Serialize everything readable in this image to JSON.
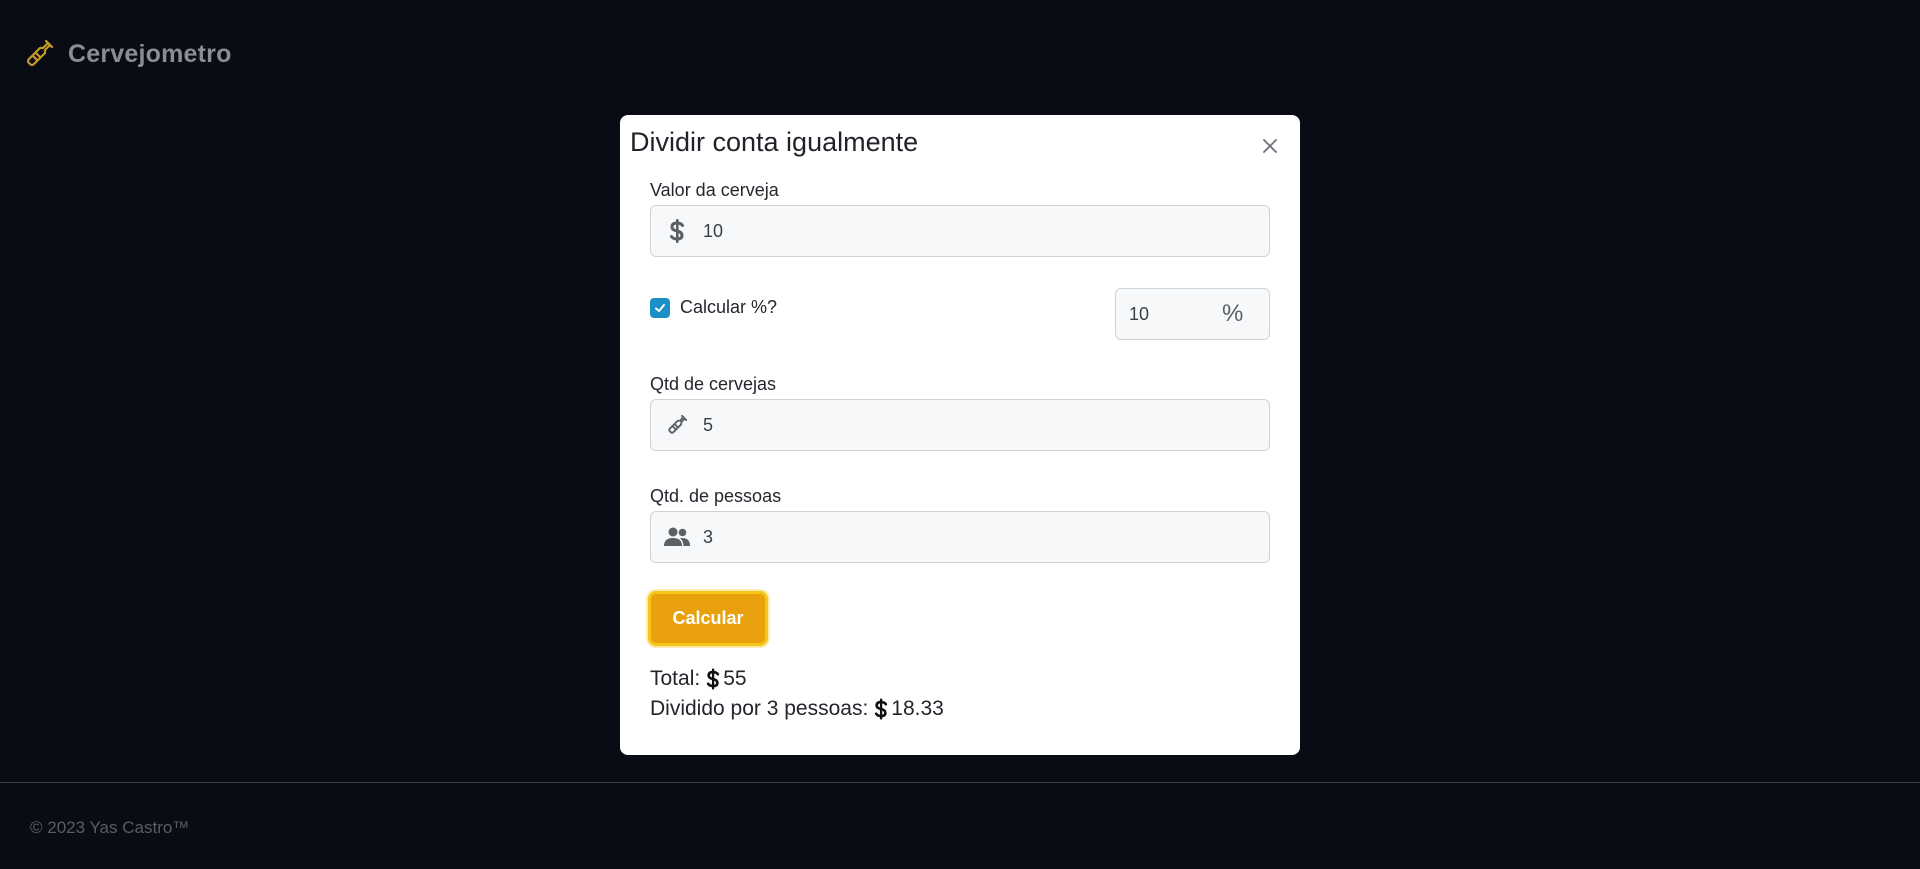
{
  "brand": {
    "name": "Cervejometro",
    "icon": "beer-bottle-icon"
  },
  "modal": {
    "title": "Dividir conta igualmente",
    "close_icon": "close-icon",
    "beer_price": {
      "label": "Valor da cerveja",
      "value": "10",
      "icon": "dollar-icon"
    },
    "percent": {
      "label": "Calcular %?",
      "checked": true,
      "value": "10",
      "suffix": "%"
    },
    "beer_qty": {
      "label": "Qtd de cervejas",
      "value": "5",
      "icon": "beer-bottle-icon"
    },
    "people_qty": {
      "label": "Qtd. de pessoas",
      "value": "3",
      "icon": "users-icon"
    },
    "calculate_label": "Calcular",
    "total_label": "Total:",
    "total_value": "55",
    "split_label": "Dividido por 3 pessoas:",
    "split_value": "18.33"
  },
  "footer": {
    "text": "© 2023 Yas Castro™"
  },
  "colors": {
    "background": "#090c14",
    "accent": "#e8a10d",
    "checkbox": "#1c90c6",
    "brand_icon": "#c59a2a"
  }
}
